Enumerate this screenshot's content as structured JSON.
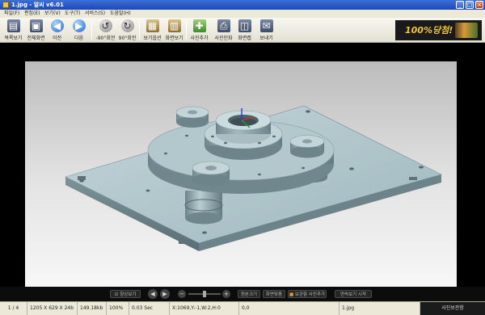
{
  "window": {
    "title": "1.jpg - 알씨 v6.01",
    "minimize": "_",
    "maximize": "□",
    "close": "×"
  },
  "menu": [
    "파일(F)",
    "편집(E)",
    "보기(V)",
    "도구(T)",
    "서비스(S)",
    "도움말(H)"
  ],
  "toolbar": {
    "list_view": "목록보기",
    "full_screen": "전체화면",
    "prev": "이전",
    "next": "다음",
    "rotate_left": "-90°회전",
    "rotate_right": "90°회전",
    "view_options": "보기옵션",
    "slideshow": "화면보기",
    "add_photo": "사진추가",
    "print_photo": "사진인화",
    "capture": "화면캡",
    "send": "보내기"
  },
  "ad": {
    "text": "100%당첨!"
  },
  "controls": {
    "always_show": "항상보기",
    "original_size": "원본크기",
    "fit_screen": "화면맞춤",
    "save_photo": "보관함 사진추가",
    "slideshow_start": "연속보기 시작"
  },
  "status": {
    "page": "1 / 4",
    "dimensions": "1205 X 629 X 24b",
    "filesize": "149.18kb",
    "zoom": "100%",
    "time": "0.03 Sec",
    "coords": "X:1069,Y:-1,W:2,H:0",
    "coord_value": "0,0",
    "filename": "1.jpg",
    "brand": "사진보관함"
  },
  "colors": {
    "titlebar": "#2457c5",
    "menubar": "#ece9d8",
    "viewer_bg": "#000000",
    "ad_text": "#f3c53a"
  }
}
